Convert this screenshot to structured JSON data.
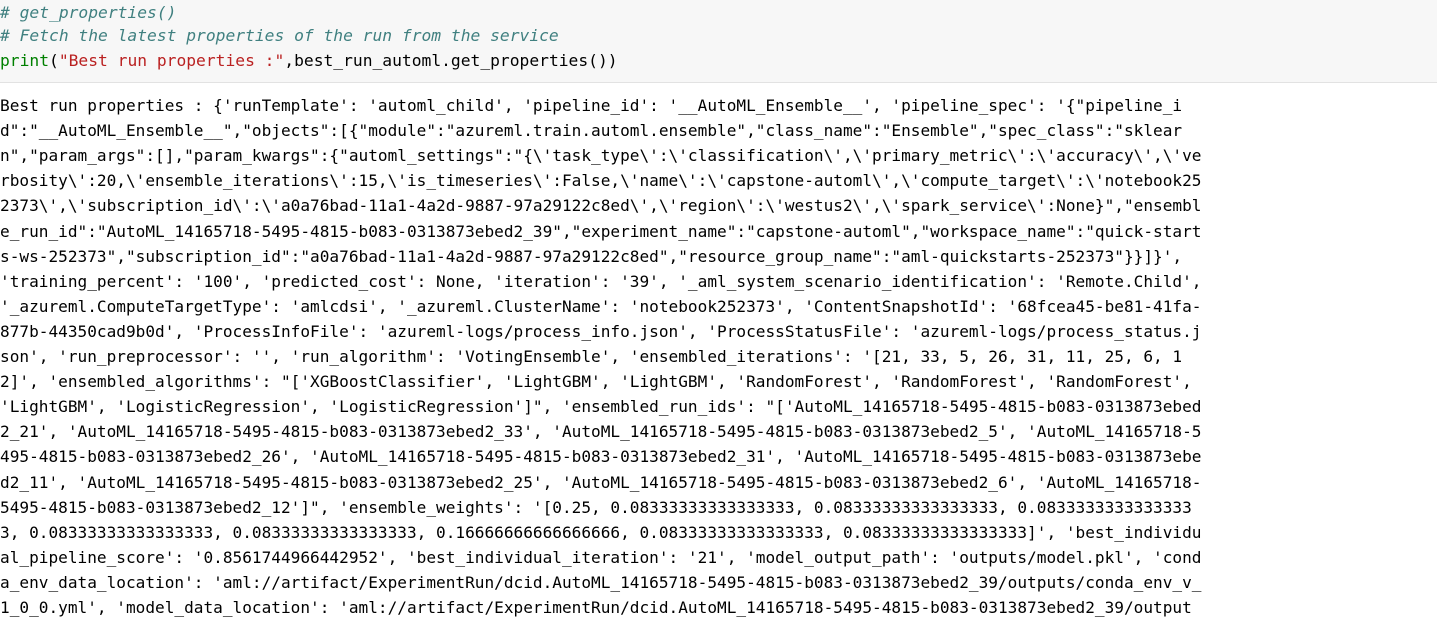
{
  "input_cell": {
    "comment_1": "# get_properties()",
    "comment_2": "# Fetch the latest properties of the run from the service",
    "print_keyword": "print",
    "open_paren": "(",
    "string_arg": "\"Best run properties :\"",
    "rest_args": ",best_run_automl.get_properties())"
  },
  "output_cell": {
    "lines": [
      "Best run properties : {'runTemplate': 'automl_child', 'pipeline_id': '__AutoML_Ensemble__', 'pipeline_spec': '{\"pipeline_i",
      "d\":\"__AutoML_Ensemble__\",\"objects\":[{\"module\":\"azureml.train.automl.ensemble\",\"class_name\":\"Ensemble\",\"spec_class\":\"sklear",
      "n\",\"param_args\":[],\"param_kwargs\":{\"automl_settings\":\"{\\'task_type\\':\\'classification\\',\\'primary_metric\\':\\'accuracy\\',\\'ve",
      "rbosity\\':20,\\'ensemble_iterations\\':15,\\'is_timeseries\\':False,\\'name\\':\\'capstone-automl\\',\\'compute_target\\':\\'notebook25",
      "2373\\',\\'subscription_id\\':\\'a0a76bad-11a1-4a2d-9887-97a29122c8ed\\',\\'region\\':\\'westus2\\',\\'spark_service\\':None}\",\"ensembl",
      "e_run_id\":\"AutoML_14165718-5495-4815-b083-0313873ebed2_39\",\"experiment_name\":\"capstone-automl\",\"workspace_name\":\"quick-start",
      "s-ws-252373\",\"subscription_id\":\"a0a76bad-11a1-4a2d-9887-97a29122c8ed\",\"resource_group_name\":\"aml-quickstarts-252373\"}}]}',",
      "'training_percent': '100', 'predicted_cost': None, 'iteration': '39', '_aml_system_scenario_identification': 'Remote.Child',",
      "'_azureml.ComputeTargetType': 'amlcdsi', '_azureml.ClusterName': 'notebook252373', 'ContentSnapshotId': '68fcea45-be81-41fa-",
      "877b-44350cad9b0d', 'ProcessInfoFile': 'azureml-logs/process_info.json', 'ProcessStatusFile': 'azureml-logs/process_status.j",
      "son', 'run_preprocessor': '', 'run_algorithm': 'VotingEnsemble', 'ensembled_iterations': '[21, 33, 5, 26, 31, 11, 25, 6, 1",
      "2]', 'ensembled_algorithms': \"['XGBoostClassifier', 'LightGBM', 'LightGBM', 'RandomForest', 'RandomForest', 'RandomForest',",
      "'LightGBM', 'LogisticRegression', 'LogisticRegression']\", 'ensembled_run_ids': \"['AutoML_14165718-5495-4815-b083-0313873ebed",
      "2_21', 'AutoML_14165718-5495-4815-b083-0313873ebed2_33', 'AutoML_14165718-5495-4815-b083-0313873ebed2_5', 'AutoML_14165718-5",
      "495-4815-b083-0313873ebed2_26', 'AutoML_14165718-5495-4815-b083-0313873ebed2_31', 'AutoML_14165718-5495-4815-b083-0313873ebe",
      "d2_11', 'AutoML_14165718-5495-4815-b083-0313873ebed2_25', 'AutoML_14165718-5495-4815-b083-0313873ebed2_6', 'AutoML_14165718-",
      "5495-4815-b083-0313873ebed2_12']\", 'ensemble_weights': '[0.25, 0.08333333333333333, 0.08333333333333333, 0.0833333333333333",
      "3, 0.08333333333333333, 0.08333333333333333, 0.16666666666666666, 0.08333333333333333, 0.08333333333333333]', 'best_individu",
      "al_pipeline_score': '0.8561744966442952', 'best_individual_iteration': '21', 'model_output_path': 'outputs/model.pkl', 'cond",
      "a_env_data_location': 'aml://artifact/ExperimentRun/dcid.AutoML_14165718-5495-4815-b083-0313873ebed2_39/outputs/conda_env_v_",
      "1_0_0.yml', 'model_data_location': 'aml://artifact/ExperimentRun/dcid.AutoML_14165718-5495-4815-b083-0313873ebed2_39/output"
    ]
  }
}
